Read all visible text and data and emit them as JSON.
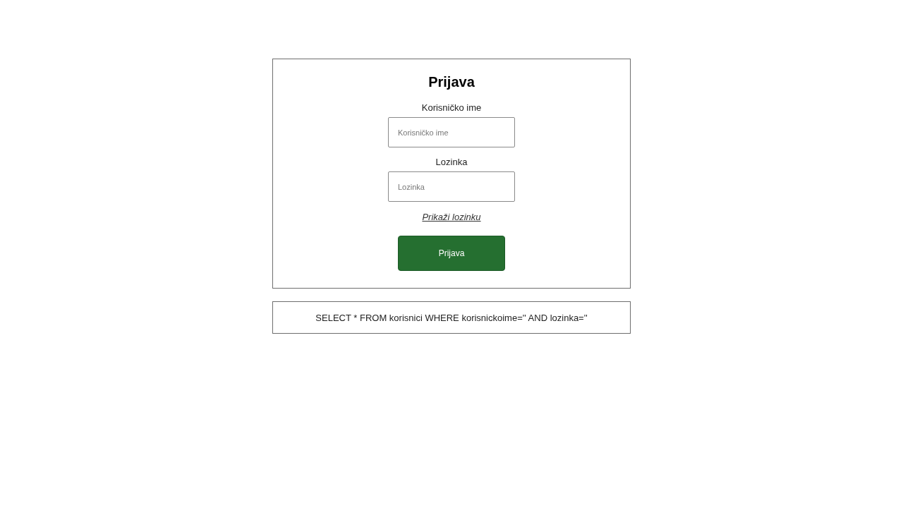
{
  "login_form": {
    "title": "Prijava",
    "fields": [
      {
        "label": "Korisničko ime",
        "placeholder": "Korisničko ime"
      },
      {
        "label": "Lozinka",
        "placeholder": "Lozinka"
      }
    ],
    "show_password_link": "Prikaži lozinku",
    "submit_button": "Prijava"
  },
  "query_panel": {
    "text": "SELECT * FROM korisnici WHERE korisnickoime='' AND lozinka=''"
  }
}
